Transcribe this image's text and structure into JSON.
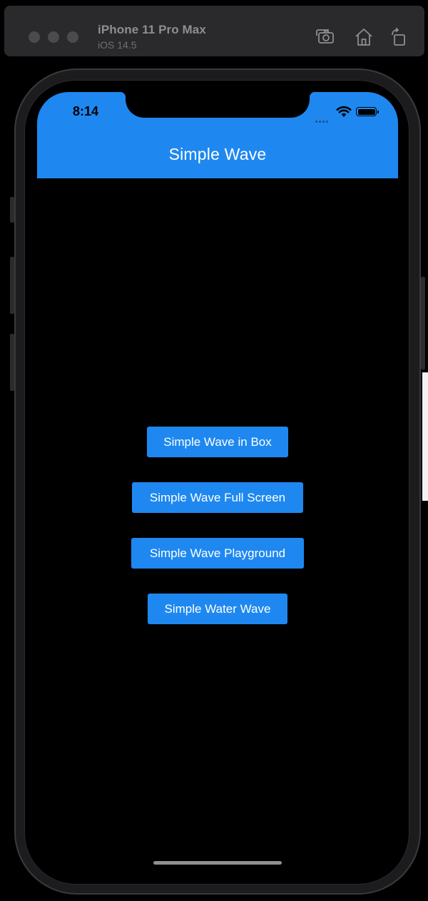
{
  "simulator": {
    "device_name": "iPhone 11 Pro Max",
    "os_version": "iOS 14.5",
    "toolbar_icons": [
      "screenshot-icon",
      "home-icon",
      "rotate-icon"
    ]
  },
  "status_bar": {
    "time": "8:14",
    "icons": [
      "cellular-signal-icon",
      "wifi-icon",
      "battery-icon"
    ]
  },
  "app_bar": {
    "title": "Simple Wave"
  },
  "buttons": [
    {
      "label": "Simple Wave in Box"
    },
    {
      "label": "Simple Wave Full Screen"
    },
    {
      "label": "Simple Wave Playground"
    },
    {
      "label": "Simple Water Wave"
    }
  ],
  "colors": {
    "accent": "#1e88f0",
    "background": "#000000",
    "button_text": "#ffffff"
  }
}
